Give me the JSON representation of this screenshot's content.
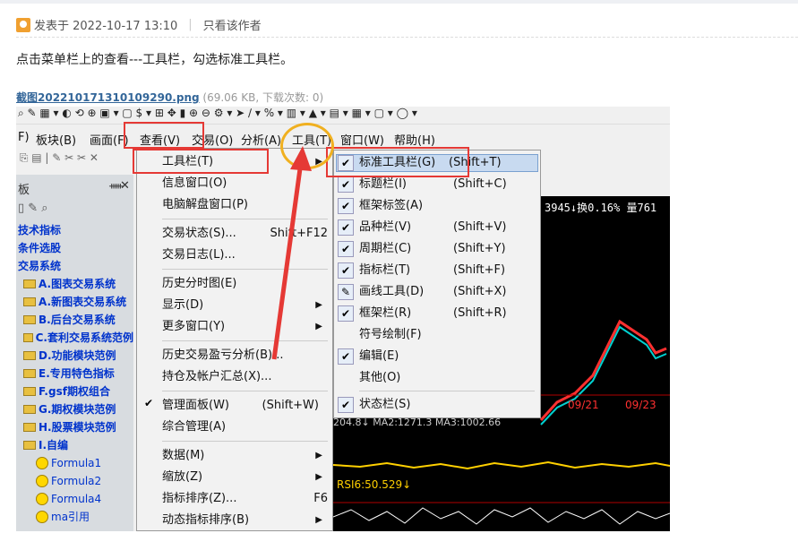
{
  "post": {
    "meta": "发表于 2022-10-17 13:10",
    "only_author": "只看该作者"
  },
  "body_text": "点击菜单栏上的查看---工具栏，勾选标准工具栏。",
  "attachment": {
    "name": "截图202210171310109290.png",
    "info": "(69.06 KB, 下载次数: 0)"
  },
  "app": {
    "menubar": [
      "F)",
      "板块(B)",
      "画面(F)",
      "查看(V)",
      "交易(O)",
      "分析(A)",
      "工具(T)",
      "窗口(W)",
      "帮助(H)"
    ],
    "panel_title": "板",
    "tree": [
      "技术指标",
      "条件选股",
      "交易系统",
      "A.图表交易系统",
      "A.新图表交易系统",
      "B.后台交易系统",
      "C.套利交易系统范例",
      "D.功能模块范例",
      "E.专用特色指标",
      "F.gsf期权组合",
      "G.期权模块范例",
      "H.股票模块范例",
      "I.自编",
      "Formula1",
      "Formula2",
      "Formula4",
      "ma引用"
    ],
    "view_menu": [
      {
        "label": "工具栏(T)",
        "shortcut": ""
      },
      {
        "label": "信息窗口(O)",
        "shortcut": ""
      },
      {
        "label": "电脑解盘窗口(P)",
        "shortcut": ""
      },
      {
        "label": "交易状态(S)...",
        "shortcut": "Shift+F12"
      },
      {
        "label": "交易日志(L)...",
        "shortcut": ""
      },
      {
        "label": "历史分时图(E)",
        "shortcut": ""
      },
      {
        "label": "显示(D)",
        "shortcut": ""
      },
      {
        "label": "更多窗口(Y)",
        "shortcut": ""
      },
      {
        "label": "历史交易盈亏分析(B)...",
        "shortcut": ""
      },
      {
        "label": "持仓及帐户汇总(X)...",
        "shortcut": ""
      },
      {
        "label": "管理面板(W)",
        "shortcut": "(Shift+W)"
      },
      {
        "label": "综合管理(A)",
        "shortcut": ""
      },
      {
        "label": "数据(M)",
        "shortcut": ""
      },
      {
        "label": "缩放(Z)",
        "shortcut": ""
      },
      {
        "label": "指标排序(Z)...",
        "shortcut": "F6"
      },
      {
        "label": "动态指标排序(B)",
        "shortcut": ""
      }
    ],
    "toolbar_menu": [
      {
        "label": "标准工具栏(G)",
        "shortcut": "(Shift+T)"
      },
      {
        "label": "标题栏(I)",
        "shortcut": "(Shift+C)"
      },
      {
        "label": "框架标签(A)",
        "shortcut": ""
      },
      {
        "label": "品种栏(V)",
        "shortcut": "(Shift+V)"
      },
      {
        "label": "周期栏(C)",
        "shortcut": "(Shift+Y)"
      },
      {
        "label": "指标栏(T)",
        "shortcut": "(Shift+F)"
      },
      {
        "label": "画线工具(D)",
        "shortcut": "(Shift+X)"
      },
      {
        "label": "框架栏(R)",
        "shortcut": "(Shift+R)"
      },
      {
        "label": "符号绘制(F)",
        "shortcut": ""
      },
      {
        "label": "编辑(E)",
        "shortcut": ""
      },
      {
        "label": "其他(O)",
        "shortcut": ""
      },
      {
        "label": "状态栏(S)",
        "shortcut": ""
      }
    ],
    "chart": {
      "quote": "3945↓换0.16% 量761",
      "dates": [
        "09/21",
        "09/23"
      ],
      "ma_text": "204.8↓ MA2:1271.3 MA3:1002.66",
      "rsi": "RSI6:50.529↓"
    }
  }
}
